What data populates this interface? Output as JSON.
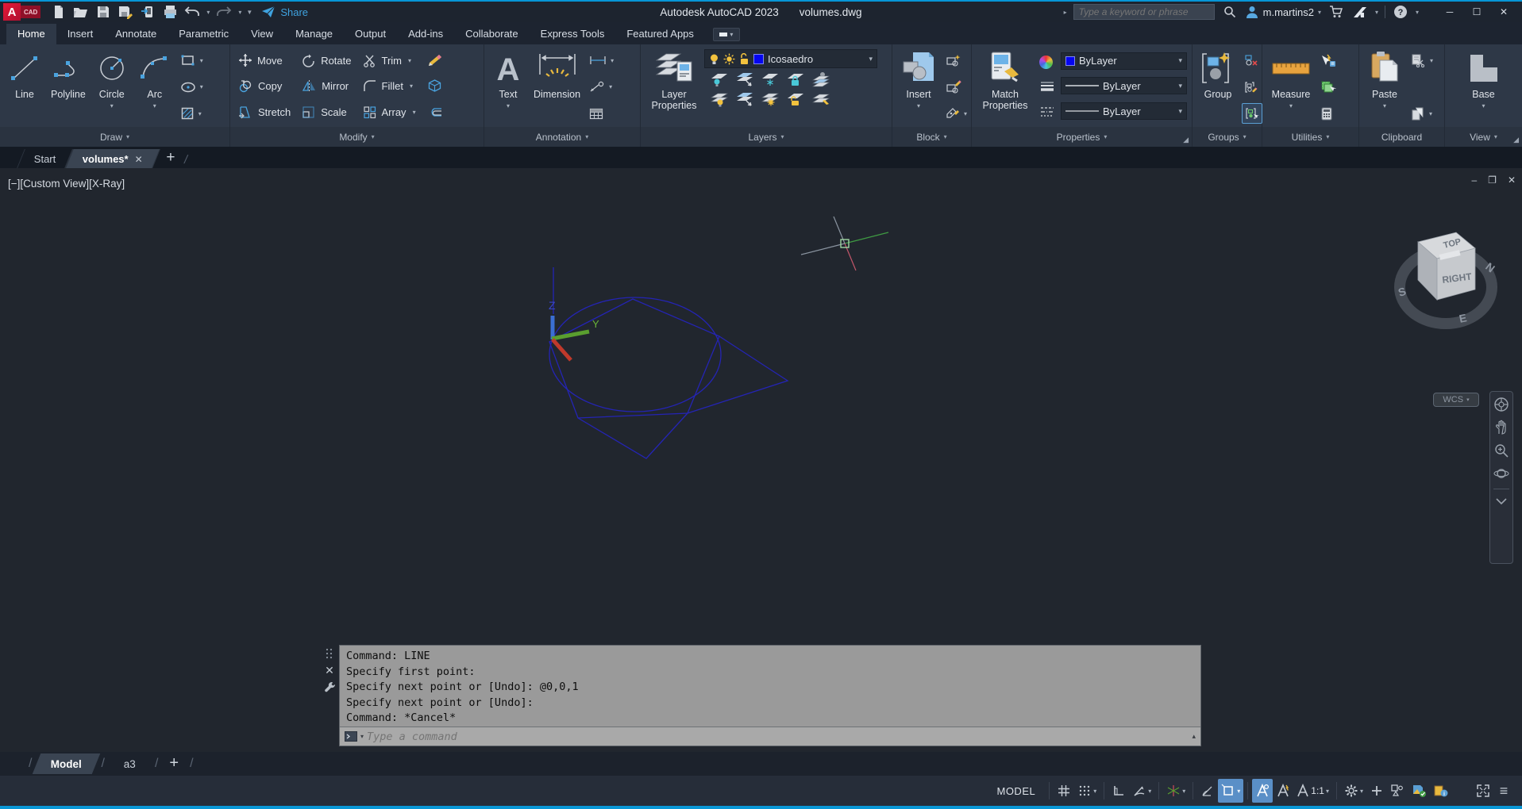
{
  "icons": {
    "chevron_down": "▾",
    "chevron_up": "▴",
    "chevron_right": "▸",
    "slash": "/",
    "plus": "+",
    "close": "✕",
    "minimize": "─",
    "maximize": "☐",
    "vp_minimize": "–",
    "vp_restore": "❐",
    "vp_close": "✕",
    "hamburger": "≡"
  },
  "titlebar": {
    "title": "Autodesk AutoCAD 2023",
    "filename": "volumes.dwg",
    "share_label": "Share",
    "search_placeholder": "Type a keyword or phrase",
    "username": "m.martins2",
    "help_glyph": "?"
  },
  "ribbon": {
    "tabs": [
      "Home",
      "Insert",
      "Annotate",
      "Parametric",
      "View",
      "Manage",
      "Output",
      "Add-ins",
      "Collaborate",
      "Express Tools",
      "Featured Apps"
    ],
    "active_tab": "Home"
  },
  "panels": {
    "draw": {
      "label": "Draw",
      "line": "Line",
      "polyline": "Polyline",
      "circle": "Circle",
      "arc": "Arc"
    },
    "modify": {
      "label": "Modify",
      "move": "Move",
      "copy": "Copy",
      "stretch": "Stretch",
      "rotate": "Rotate",
      "mirror": "Mirror",
      "scale": "Scale",
      "trim": "Trim",
      "fillet": "Fillet",
      "array": "Array"
    },
    "annotation": {
      "label": "Annotation",
      "text": "Text",
      "dimension": "Dimension"
    },
    "layers": {
      "label": "Layers",
      "layer_properties_line1": "Layer",
      "layer_properties_line2": "Properties",
      "current_layer": "Icosaedro"
    },
    "block": {
      "label": "Block",
      "insert": "Insert"
    },
    "properties": {
      "label": "Properties",
      "match_line1": "Match",
      "match_line2": "Properties",
      "color_value": "ByLayer",
      "lineweight_value": "ByLayer",
      "linetype_value": "ByLayer"
    },
    "groups": {
      "label": "Groups",
      "group": "Group"
    },
    "utilities": {
      "label": "Utilities",
      "measure": "Measure"
    },
    "clipboard": {
      "label": "Clipboard",
      "paste": "Paste"
    },
    "view": {
      "label": "View",
      "base": "Base"
    }
  },
  "file_tabs": {
    "start": "Start",
    "active_doc": "volumes*"
  },
  "viewport": {
    "controls": "[−][Custom View][X-Ray]",
    "ucs_z": "Z",
    "ucs_y": "Y",
    "viewcube": {
      "top": "TOP",
      "front": "RIGHT",
      "north": "N",
      "south": "S",
      "east": "E",
      "wcs": "WCS"
    }
  },
  "command_window": {
    "lines": [
      "Command: LINE",
      "Specify first point:",
      "Specify next point or [Undo]: @0,0,1",
      "Specify next point or [Undo]:",
      "Command: *Cancel*"
    ],
    "placeholder": "Type a command"
  },
  "layout_tabs": {
    "model": "Model",
    "layout": "a3"
  },
  "status_bar": {
    "model": "MODEL",
    "annotation_scale": "1:1"
  }
}
